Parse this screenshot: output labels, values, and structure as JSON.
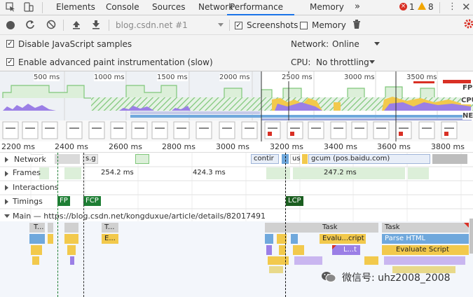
{
  "tabs": {
    "items": [
      "Elements",
      "Console",
      "Sources",
      "Network",
      "Performance",
      "Memory"
    ],
    "more": "»",
    "errors": "1",
    "warnings": "8"
  },
  "toolbar": {
    "profile_select": "blog.csdn.net #1",
    "screenshots_label": "Screenshots",
    "memory_label": "Memory"
  },
  "settings": {
    "disable_js_samples": "Disable JavaScript samples",
    "paint_instrumentation": "Enable advanced paint instrumentation (slow)",
    "network_label": "Network:",
    "network_value": "Online",
    "cpu_label": "CPU:",
    "cpu_value": "No throttling"
  },
  "overview": {
    "ticks": [
      "500 ms",
      "1000 ms",
      "1500 ms",
      "2000 ms",
      "2500 ms",
      "3000 ms",
      "3500 ms"
    ],
    "side_labels": [
      "FPS",
      "CPU",
      "NET"
    ]
  },
  "ruler": {
    "ticks": [
      "2200 ms",
      "2400 ms",
      "2600 ms",
      "2800 ms",
      "3000 ms",
      "3200 ms",
      "3400 ms",
      "3600 ms",
      "3800 ms"
    ]
  },
  "tracks": {
    "network": "Network",
    "network_items": [
      "s.g",
      "cont​ir",
      "us",
      "gcum (pos.baidu.com)"
    ],
    "frames": "Frames",
    "frame_times": [
      "254.2 ms",
      "424.3 ms",
      "247.2 ms"
    ],
    "interactions": "Interactions",
    "timings": "Timings",
    "timing_markers": [
      "FP",
      "FCP",
      "LCP"
    ],
    "main": "Main — https://blog.csdn.net/kongduxue/article/details/82017491",
    "main_labels": [
      "T...",
      "T...",
      "E...",
      "Task",
      "Task",
      "Evalu...cript",
      "Parse HTML",
      "Evaluate Script",
      "L...t"
    ]
  },
  "watermark": {
    "text": "微信号: uhz2008_2008"
  },
  "colors": {
    "accent": "#1a73e8",
    "scripting": "#f2c94c",
    "rendering": "#9b7fe6",
    "loading": "#6fa8dc",
    "painting": "#7fc77a",
    "fp": "#1e7e34",
    "lcp": "#1b5e20",
    "error": "#d93025",
    "warning": "#f2a600"
  }
}
